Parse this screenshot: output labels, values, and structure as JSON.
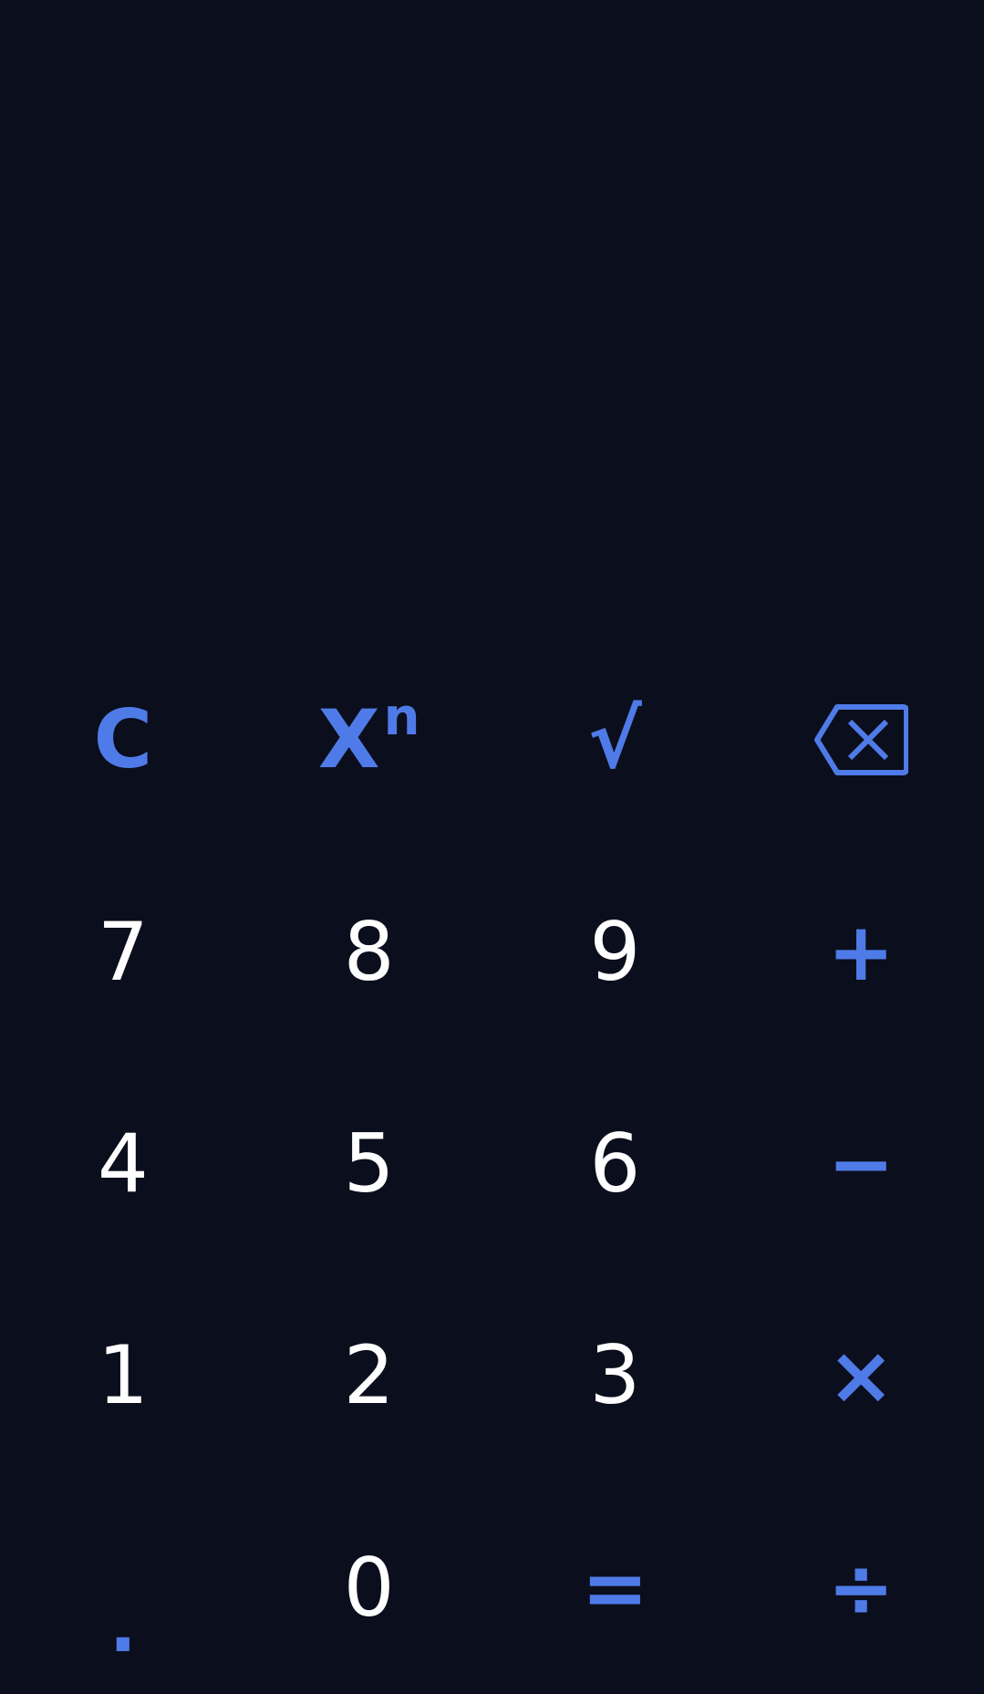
{
  "display": {
    "expression": "",
    "result": ""
  },
  "colors": {
    "background": "#0b0e1c",
    "digit": "#ffffff",
    "accent": "#4f7be8"
  },
  "keys": {
    "clear": "C",
    "power_base": "X",
    "power_exp": "n",
    "sqrt": "√",
    "backspace_icon": "backspace-icon",
    "seven": "7",
    "eight": "8",
    "nine": "9",
    "plus": "+",
    "four": "4",
    "five": "5",
    "six": "6",
    "minus": "−",
    "one": "1",
    "two": "2",
    "three": "3",
    "multiply": "×",
    "dot": ".",
    "zero": "0",
    "equals": "=",
    "divide": "÷"
  }
}
